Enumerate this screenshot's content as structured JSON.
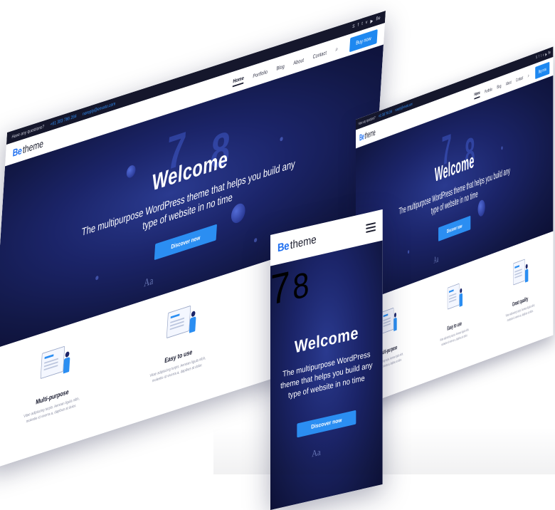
{
  "topbar": {
    "question": "Have any questions?",
    "phone": "+61 383 766 284",
    "email": "noreply@envato.com",
    "social_icons": [
      "skype-icon",
      "facebook-icon",
      "twitter-icon",
      "vimeo-icon",
      "youtube-icon",
      "behance-icon"
    ],
    "social_glyphs": [
      "S",
      "f",
      "t",
      "v",
      "▶",
      "Be"
    ]
  },
  "header": {
    "logo_be": "Be",
    "logo_theme": "theme",
    "nav": [
      "Home",
      "Portfolio",
      "Blog",
      "About",
      "Contact"
    ],
    "search_glyph": "⌕",
    "buy_label": "Buy now"
  },
  "hero": {
    "title": "Welcome",
    "subtitle": "The multipurpose WordPress theme that helps you build any type of website in no time",
    "cta_label": "Discover now",
    "aa": "Aa"
  },
  "features": [
    {
      "title": "Multi-purpose",
      "text": "Vitae adipiscing turpis. Aenean ligula nibh, molestie id viverra a, dapibus at dolor."
    },
    {
      "title": "Easy to use",
      "text": "Vitae adipiscing turpis. Aenean ligula nibh, molestie id viverra a, dapibus at dolor."
    },
    {
      "title": "Great quality",
      "text": "Vitae adipiscing turpis. Aenean ligula nibh, molestie id viverra a, dapibus at dolor."
    }
  ],
  "colors": {
    "accent": "#2b8ef2",
    "hero_dark": "#121846",
    "topbar": "#15172c",
    "logo_be": "#1e6ff0"
  }
}
